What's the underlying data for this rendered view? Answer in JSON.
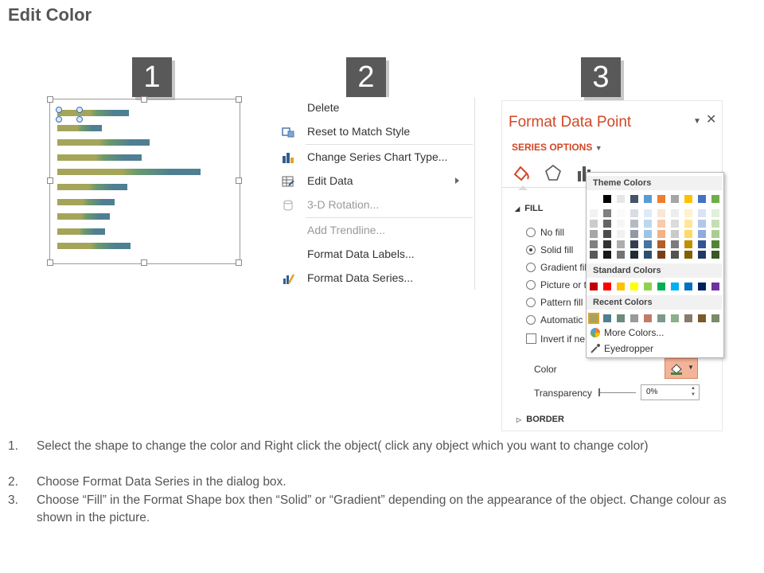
{
  "page": {
    "title": "Edit Color"
  },
  "steps": {
    "one": "1",
    "two": "2",
    "three": "3"
  },
  "context_menu": {
    "items": [
      {
        "label": "Delete",
        "icon": "none",
        "disabled": false
      },
      {
        "label": "Reset to Match Style",
        "icon": "reset-style-icon",
        "disabled": false
      },
      {
        "label": "Change Series Chart Type...",
        "icon": "chart-type-icon",
        "disabled": false
      },
      {
        "label": "Edit Data",
        "icon": "edit-data-icon",
        "disabled": false,
        "submenu": true
      },
      {
        "label": "3-D Rotation...",
        "icon": "rotation-icon",
        "disabled": true
      },
      {
        "label": "Add Trendline...",
        "icon": "none",
        "disabled": true
      },
      {
        "label": "Format Data Labels...",
        "icon": "none",
        "disabled": false
      },
      {
        "label": "Format Data Series...",
        "icon": "format-series-icon",
        "disabled": false
      }
    ]
  },
  "format_pane": {
    "title": "Format Data Point",
    "series_options": "SERIES OPTIONS",
    "fill_section": "FILL",
    "options": [
      "No fill",
      "Solid fill",
      "Gradient fil",
      "Picture or t",
      "Pattern fill",
      "Automatic"
    ],
    "selected": "Solid fill",
    "invert": "Invert if ne",
    "color_label": "Color",
    "transparency_label": "Transparency",
    "transparency_value": "0%",
    "border_section": "BORDER"
  },
  "palette": {
    "theme_header": "Theme Colors",
    "standard_header": "Standard Colors",
    "recent_header": "Recent Colors",
    "more_colors": "More Colors...",
    "eyedropper": "Eyedropper",
    "theme_top": [
      "#ffffff",
      "#000000",
      "#e7e6e6",
      "#44546a",
      "#5b9bd5",
      "#ed7d31",
      "#a5a5a5",
      "#ffc000",
      "#4472c4",
      "#70ad47"
    ],
    "standard": [
      "#c00000",
      "#ff0000",
      "#ffc000",
      "#ffff00",
      "#92d050",
      "#00b050",
      "#00b0f0",
      "#0070c0",
      "#002060",
      "#7030a0"
    ],
    "recent": [
      "#a5a55a",
      "#4e7f92",
      "#6c8b7b",
      "#9a9a9a",
      "#c07c6a",
      "#7c9a8a",
      "#8ab08a",
      "#8a7a6a",
      "#7a5a2a",
      "#7a8a6a"
    ]
  },
  "instructions": [
    {
      "num": "1.",
      "text": "Select the shape to change the color and Right click the object( click any object which you want to change color)"
    },
    {
      "num": "2.",
      "text": "Choose Format Data Series in the dialog box."
    },
    {
      "num": "3.",
      "text": "Choose “Fill” in the Format Shape box then “Solid” or “Gradient” depending on the appearance of the object. Change colour as shown in the picture."
    }
  ],
  "colors": {
    "accent": "#d24726",
    "bar_olive": "#a5a55a",
    "bar_green": "#6c9a6c",
    "bar_blue": "#4e7f92"
  }
}
